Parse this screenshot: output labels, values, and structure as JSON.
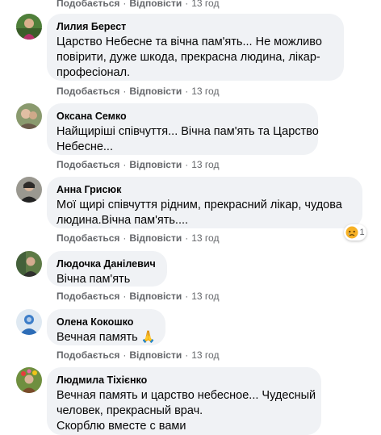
{
  "actions": {
    "like": "Подобається",
    "reply": "Відповісти",
    "separator": "·"
  },
  "top_meta": {
    "time": "13 год"
  },
  "comments": [
    {
      "author": "Лилия Берест",
      "lines": [
        "Царство Небесне та вічна пам'ять... Не можливо",
        "повірити, дуже шкода, прекрасна людина, лікар-",
        "професіонал."
      ],
      "time": "13 год"
    },
    {
      "author": "Оксана Семко",
      "lines": [
        "Найщиріші співчуття... Вічна пам'ять та Царство",
        "Небесне..."
      ],
      "time": "13 год"
    },
    {
      "author": "Анна Грисюк",
      "lines": [
        "Мої щирі співчуття рідним, прекрасний лікар, чудова",
        "людина.Вічна пам'ять...."
      ],
      "time": "13 год",
      "reaction": {
        "icon": "sad-reaction-icon",
        "count": "1"
      }
    },
    {
      "author": "Людочка Данілевич",
      "lines": [
        "Вічна пам'ять"
      ],
      "time": "13 год"
    },
    {
      "author": "Олена Кокошко",
      "lines": [
        "Вечная память"
      ],
      "emoji": "🙏",
      "time": "13 год"
    },
    {
      "author": "Людмила Тіхієнко",
      "lines": [
        "Вечная память и царство небесное... Чудесный",
        "человек, прекрасный врач.",
        "Скорблю вместе с вами"
      ]
    }
  ],
  "colors": {
    "bubble": "#f0f2f5",
    "meta": "#65676b",
    "text": "#050505",
    "sad_reaction": "#f7b125"
  }
}
